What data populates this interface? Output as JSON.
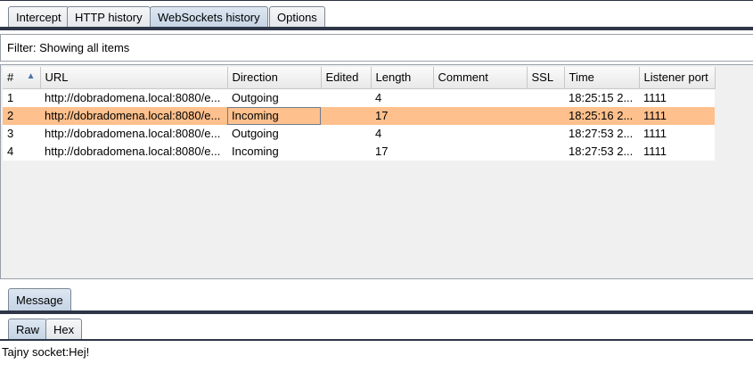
{
  "tabs": [
    "Intercept",
    "HTTP history",
    "WebSockets history",
    "Options"
  ],
  "filter": {
    "text": "Filter: Showing all items"
  },
  "table": {
    "columns": [
      "#",
      "URL",
      "Direction",
      "Edited",
      "Length",
      "Comment",
      "SSL",
      "Time",
      "Listener port"
    ],
    "rows": [
      [
        "1",
        "http://dobradomena.local:8080/e...",
        "Outgoing",
        "",
        "4",
        "",
        "",
        "18:25:15 2...",
        "1111"
      ],
      [
        "2",
        "http://dobradomena.local:8080/e...",
        "Incoming",
        "",
        "17",
        "",
        "",
        "18:25:16 2...",
        "1111"
      ],
      [
        "3",
        "http://dobradomena.local:8080/e...",
        "Outgoing",
        "",
        "4",
        "",
        "",
        "18:27:53 2...",
        "1111"
      ],
      [
        "4",
        "http://dobradomena.local:8080/e...",
        "Incoming",
        "",
        "17",
        "",
        "",
        "18:27:53 2...",
        "1111"
      ]
    ],
    "selected_row": 2,
    "selected_highlight": "#fec08d",
    "sort_icon": "sort-ascending-icon"
  },
  "message_tabs": [
    "Message"
  ],
  "view_tabs": [
    "Raw",
    "Hex"
  ],
  "message_content": "Tajny socket:Hej!"
}
